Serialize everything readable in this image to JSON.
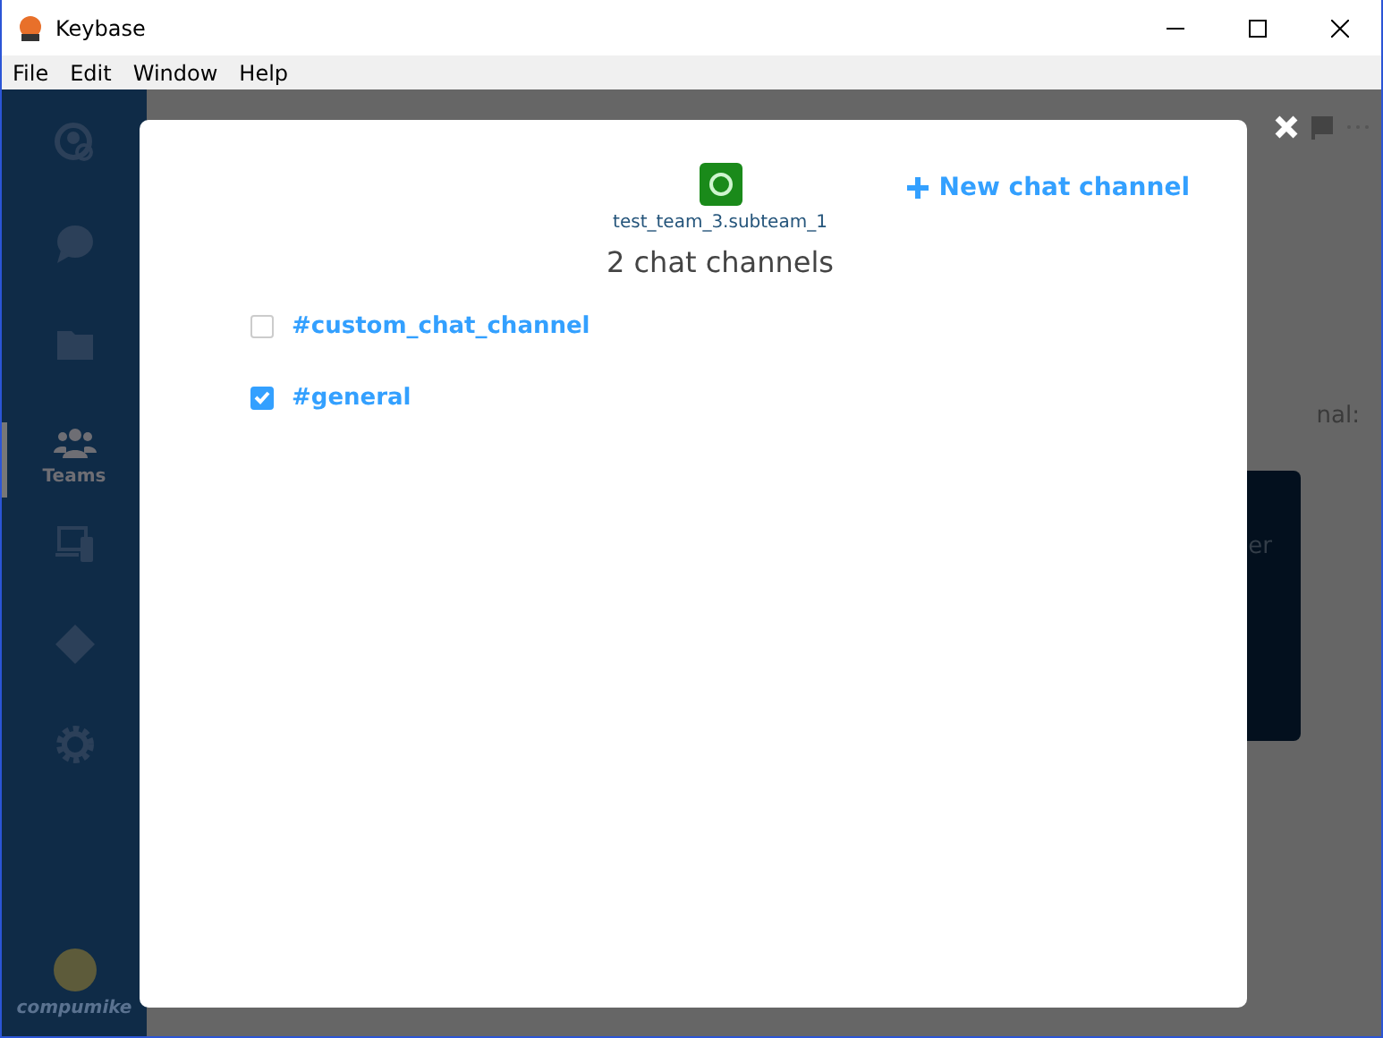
{
  "window": {
    "title": "Keybase"
  },
  "menu": [
    "File",
    "Edit",
    "Window",
    "Help"
  ],
  "sidebar": {
    "items": [
      {
        "kind": "people",
        "selected": false
      },
      {
        "kind": "chat",
        "selected": false
      },
      {
        "kind": "files",
        "selected": false
      },
      {
        "kind": "teams",
        "label": "Teams",
        "selected": true
      },
      {
        "kind": "devices",
        "selected": false
      },
      {
        "kind": "git",
        "selected": false
      },
      {
        "kind": "settings",
        "selected": false
      }
    ],
    "user": "compumike"
  },
  "background": {
    "text_fragment": "nal:",
    "panel_fragment": "er"
  },
  "modal": {
    "team_name": "test_team_3.subteam_1",
    "new_channel": "New chat channel",
    "heading": "2 chat channels",
    "channels": [
      {
        "name": "#custom_chat_channel",
        "checked": false
      },
      {
        "name": "#general",
        "checked": true
      }
    ]
  }
}
